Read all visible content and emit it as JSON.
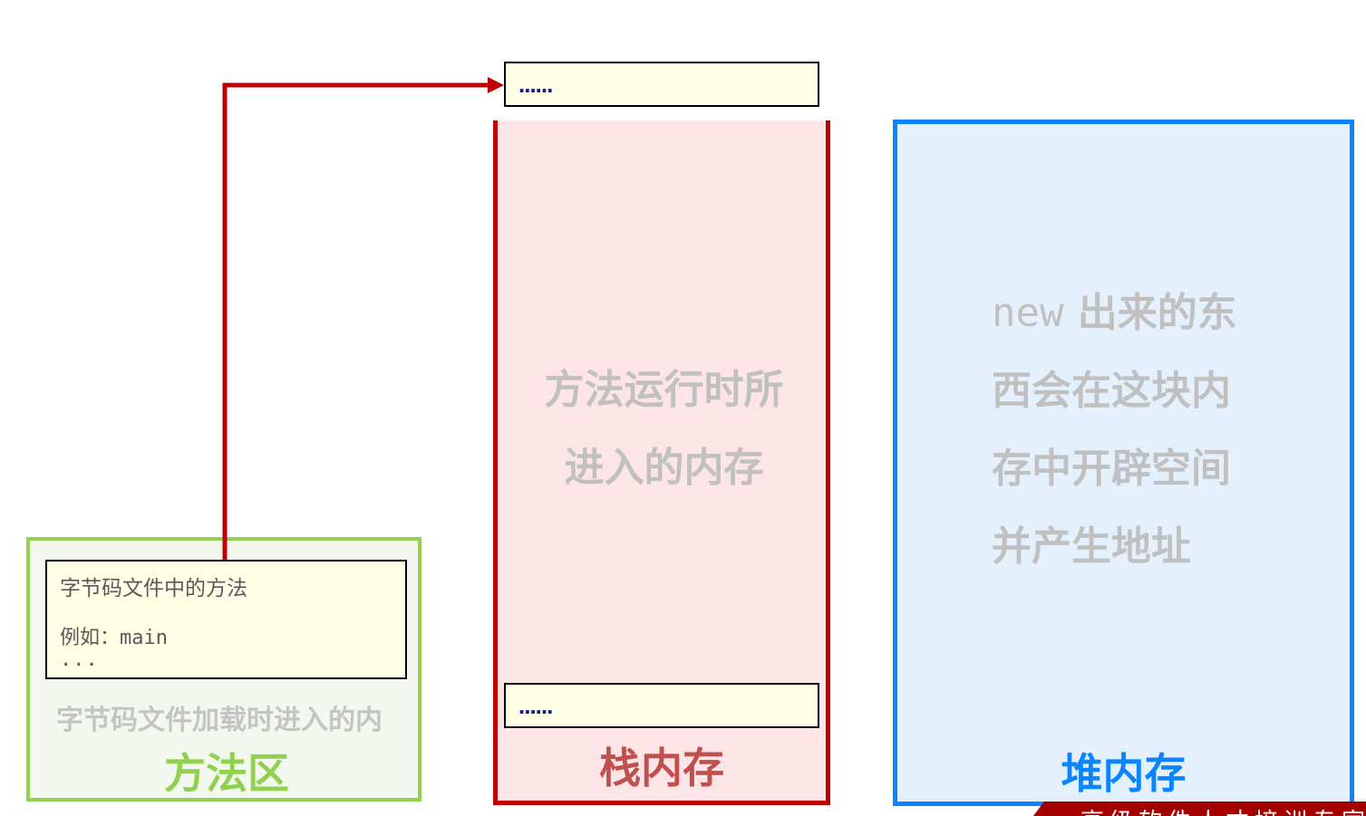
{
  "method_area": {
    "title": "方法区",
    "description": "字节码文件加载时进入的内",
    "card": {
      "line1": "字节码文件中的方法",
      "line2_prefix": "例如：",
      "line2_code": "main",
      "line3": "..."
    }
  },
  "stack_memory": {
    "title": "栈内存",
    "description_line1": "方法运行时所",
    "description_line2": "进入的内存",
    "top_frame": "......",
    "bottom_frame": "......"
  },
  "heap_memory": {
    "title": "堆内存",
    "description_code": "new",
    "description_line1_rest": " 出来的东",
    "description_line2": "西会在这块内",
    "description_line3": "存中开辟空间",
    "description_line4": "并产生地址"
  },
  "colors": {
    "method_area": "#92d050",
    "stack": "#c00000",
    "stack_title": "#c0504d",
    "heap": "#0a84ff",
    "description_gray": "#c0c0c0",
    "card_fill": "#ffffe6",
    "dots": "#0a1b8c"
  },
  "banner": {
    "text": "高级软件人才培训专家"
  }
}
